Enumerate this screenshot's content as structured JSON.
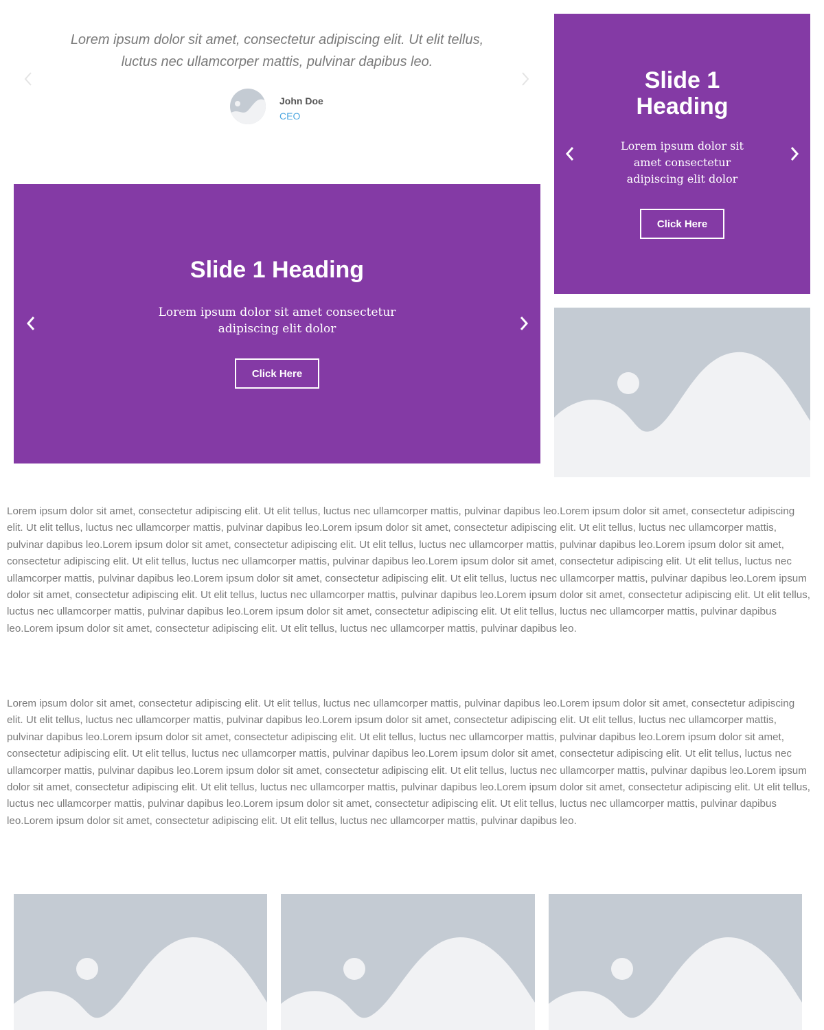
{
  "testimonial": {
    "quote": "Lorem ipsum dolor sit amet, consectetur adipiscing elit. Ut elit tellus, luctus nec ullamcorper mattis, pulvinar dapibus leo.",
    "name": "John Doe",
    "role": "CEO",
    "icons": {
      "prev": "chevron-left-icon",
      "next": "chevron-right-icon",
      "avatar": "avatar-placeholder-icon"
    }
  },
  "slide_wide": {
    "heading": "Slide 1 Heading",
    "description": "Lorem ipsum dolor sit amet consectetur adipiscing elit dolor",
    "button_label": "Click Here"
  },
  "slide_narrow": {
    "heading": "Slide 1 Heading",
    "description": "Lorem ipsum dolor sit amet consectetur adipiscing elit dolor",
    "button_label": "Click Here"
  },
  "paragraphs": [
    "Lorem ipsum dolor sit amet, consectetur adipiscing elit. Ut elit tellus, luctus nec ullamcorper mattis, pulvinar dapibus leo.Lorem ipsum dolor sit amet, consectetur adipiscing elit. Ut elit tellus, luctus nec ullamcorper mattis, pulvinar dapibus leo.Lorem ipsum dolor sit amet, consectetur adipiscing elit. Ut elit tellus, luctus nec ullamcorper mattis, pulvinar dapibus leo.Lorem ipsum dolor sit amet, consectetur adipiscing elit. Ut elit tellus, luctus nec ullamcorper mattis, pulvinar dapibus leo.Lorem ipsum dolor sit amet, consectetur adipiscing elit. Ut elit tellus, luctus nec ullamcorper mattis, pulvinar dapibus leo.Lorem ipsum dolor sit amet, consectetur adipiscing elit. Ut elit tellus, luctus nec ullamcorper mattis, pulvinar dapibus leo.Lorem ipsum dolor sit amet, consectetur adipiscing elit. Ut elit tellus, luctus nec ullamcorper mattis, pulvinar dapibus leo.Lorem ipsum dolor sit amet, consectetur adipiscing elit. Ut elit tellus, luctus nec ullamcorper mattis, pulvinar dapibus leo.Lorem ipsum dolor sit amet, consectetur adipiscing elit. Ut elit tellus, luctus nec ullamcorper mattis, pulvinar dapibus leo.Lorem ipsum dolor sit amet, consectetur adipiscing elit. Ut elit tellus, luctus nec ullamcorper mattis, pulvinar dapibus leo.Lorem ipsum dolor sit amet, consectetur adipiscing elit. Ut elit tellus, luctus nec ullamcorper mattis, pulvinar dapibus leo.",
    "Lorem ipsum dolor sit amet, consectetur adipiscing elit. Ut elit tellus, luctus nec ullamcorper mattis, pulvinar dapibus leo.Lorem ipsum dolor sit amet, consectetur adipiscing elit. Ut elit tellus, luctus nec ullamcorper mattis, pulvinar dapibus leo.Lorem ipsum dolor sit amet, consectetur adipiscing elit. Ut elit tellus, luctus nec ullamcorper mattis, pulvinar dapibus leo.Lorem ipsum dolor sit amet, consectetur adipiscing elit. Ut elit tellus, luctus nec ullamcorper mattis, pulvinar dapibus leo.Lorem ipsum dolor sit amet, consectetur adipiscing elit. Ut elit tellus, luctus nec ullamcorper mattis, pulvinar dapibus leo.Lorem ipsum dolor sit amet, consectetur adipiscing elit. Ut elit tellus, luctus nec ullamcorper mattis, pulvinar dapibus leo.Lorem ipsum dolor sit amet, consectetur adipiscing elit. Ut elit tellus, luctus nec ullamcorper mattis, pulvinar dapibus leo.Lorem ipsum dolor sit amet, consectetur adipiscing elit. Ut elit tellus, luctus nec ullamcorper mattis, pulvinar dapibus leo.Lorem ipsum dolor sit amet, consectetur adipiscing elit. Ut elit tellus, luctus nec ullamcorper mattis, pulvinar dapibus leo.Lorem ipsum dolor sit amet, consectetur adipiscing elit. Ut elit tellus, luctus nec ullamcorper mattis, pulvinar dapibus leo.Lorem ipsum dolor sit amet, consectetur adipiscing elit. Ut elit tellus, luctus nec ullamcorper mattis, pulvinar dapibus leo."
  ],
  "images": {
    "icon": "image-placeholder-icon"
  },
  "colors": {
    "slide_bg": "#843aa5",
    "placeholder_bg": "#c4cbd3",
    "placeholder_fg": "#f1f2f4",
    "text": "#7a7a7a",
    "role_link": "#4fa8e0"
  }
}
